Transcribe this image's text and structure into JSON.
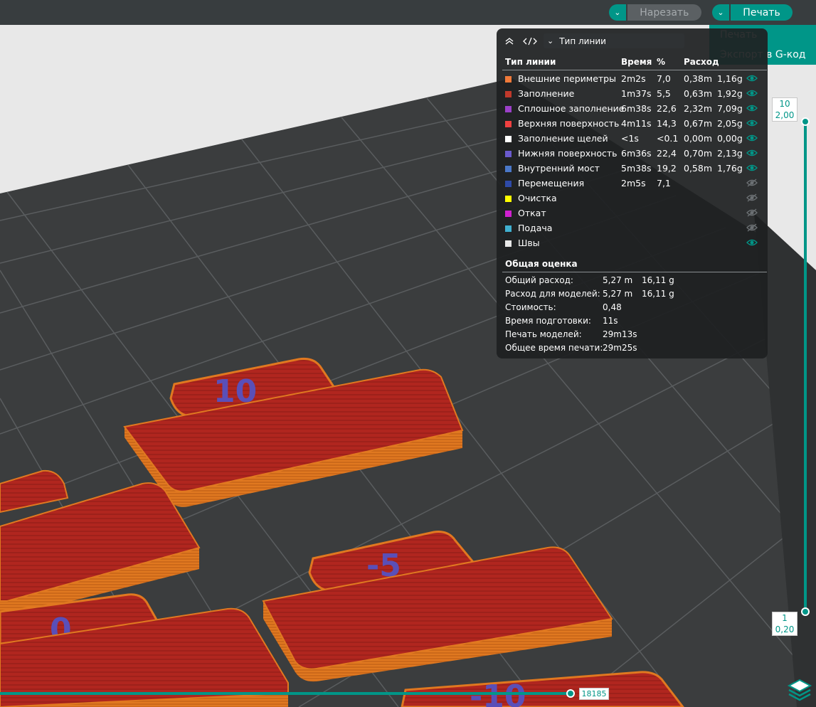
{
  "toolbar": {
    "slice_label": "Нарезать",
    "print_label": "Печать"
  },
  "print_menu": {
    "items": [
      "Печать",
      "Экспорт в G-код"
    ]
  },
  "legend": {
    "dropdown_value": "Тип линии",
    "headers": {
      "type": "Тип линии",
      "time": "Время",
      "percent": "%",
      "usage": "Расход"
    },
    "rows": [
      {
        "color": "#f07a3a",
        "name": "Внешние периметры",
        "time": "2m2s",
        "percent": "7,0",
        "length": "0,38m",
        "weight": "1,16g",
        "visible": true
      },
      {
        "color": "#c0392b",
        "name": "Заполнение",
        "time": "1m37s",
        "percent": "5,5",
        "length": "0,63m",
        "weight": "1,92g",
        "visible": true
      },
      {
        "color": "#9b40c8",
        "name": "Сплошное заполнение",
        "time": "6m38s",
        "percent": "22,6",
        "length": "2,32m",
        "weight": "7,09g",
        "visible": true
      },
      {
        "color": "#f04040",
        "name": "Верхняя поверхность",
        "time": "4m11s",
        "percent": "14,3",
        "length": "0,67m",
        "weight": "2,05g",
        "visible": true
      },
      {
        "color": "#ffffff",
        "name": "Заполнение щелей",
        "time": "<1s",
        "percent": "<0.1",
        "length": "0,00m",
        "weight": "0,00g",
        "visible": true
      },
      {
        "color": "#6a5acd",
        "name": "Нижняя поверхность",
        "time": "6m36s",
        "percent": "22,4",
        "length": "0,70m",
        "weight": "2,13g",
        "visible": true
      },
      {
        "color": "#4a78c8",
        "name": "Внутренний мост",
        "time": "5m38s",
        "percent": "19,2",
        "length": "0,58m",
        "weight": "1,76g",
        "visible": true
      },
      {
        "color": "#2e4aa8",
        "name": "Перемещения",
        "time": "2m5s",
        "percent": "7,1",
        "length": "",
        "weight": "",
        "visible": false
      },
      {
        "color": "#ffff00",
        "name": "Очистка",
        "time": "",
        "percent": "",
        "length": "",
        "weight": "",
        "visible": false
      },
      {
        "color": "#d020d0",
        "name": "Откат",
        "time": "",
        "percent": "",
        "length": "",
        "weight": "",
        "visible": false
      },
      {
        "color": "#40b0d0",
        "name": "Подача",
        "time": "",
        "percent": "",
        "length": "",
        "weight": "",
        "visible": false
      },
      {
        "color": "#e8e8e8",
        "name": "Швы",
        "time": "",
        "percent": "",
        "length": "",
        "weight": "",
        "visible": true
      }
    ],
    "summary_title": "Общая оценка",
    "summary": [
      {
        "label": "Общий расход:",
        "v1": "5,27 m",
        "v2": "16,11 g"
      },
      {
        "label": "Расход для моделей:",
        "v1": "5,27 m",
        "v2": "16,11 g"
      },
      {
        "label": "Стоимость:",
        "v1": "0,48",
        "v2": ""
      },
      {
        "label": "Время подготовки:",
        "v1": "11s",
        "v2": ""
      },
      {
        "label": "Печать моделей:",
        "v1": "29m13s",
        "v2": ""
      },
      {
        "label": "Общее время печати:",
        "v1": "29m25s",
        "v2": ""
      }
    ]
  },
  "layer_slider": {
    "top_layer": "10",
    "top_height": "2,00",
    "bottom_layer": "1",
    "bottom_height": "0,20"
  },
  "move_slider": {
    "value": "18185"
  },
  "viewport": {
    "labels": [
      "10",
      "-5",
      "0",
      "-10"
    ]
  },
  "colors": {
    "accent": "#009688",
    "part_top": "#b52a24",
    "part_side": "#e07820",
    "label_blue": "#5a4fb8"
  }
}
